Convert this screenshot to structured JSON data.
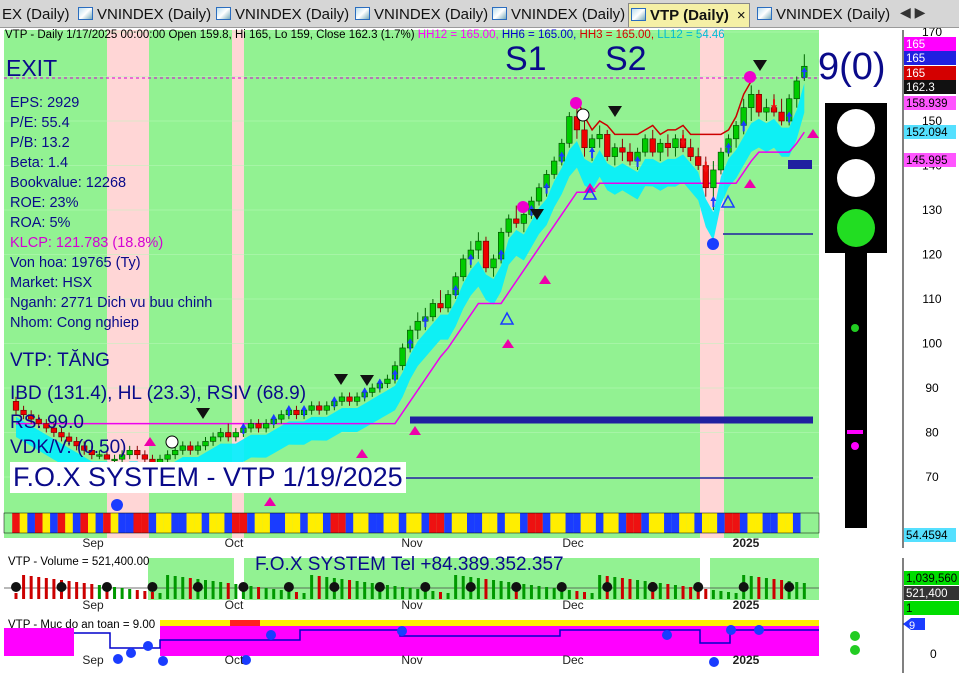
{
  "tabs": [
    {
      "label": "EX (Daily)",
      "active": false
    },
    {
      "label": "VNINDEX (Daily)",
      "active": false
    },
    {
      "label": "VNINDEX (Daily)",
      "active": false
    },
    {
      "label": "VNINDEX (Daily)",
      "active": false
    },
    {
      "label": "VNINDEX (Daily)",
      "active": false
    },
    {
      "label": "VTP (Daily)",
      "active": true
    },
    {
      "label": "VNINDEX (Daily)",
      "active": false
    }
  ],
  "tab_close": "×",
  "tab_nav": "◀ ▶",
  "header_parts": [
    {
      "text": "VTP - Daily 1/17/2025 00:00:00 Open 159.8, Hi 165, Lo 159, Close 162.3 (1.7%) ",
      "color": "#000000"
    },
    {
      "text": "HH12 = 165.00, ",
      "color": "#ff00ff"
    },
    {
      "text": "HH6 = 165.00, ",
      "color": "#0000cc"
    },
    {
      "text": "HH3 = 165.00, ",
      "color": "#d40000"
    },
    {
      "text": "LL12 = 54.46",
      "color": "#00bcd4"
    }
  ],
  "exit_label": "EXIT",
  "s1_label": "S1",
  "s2_label": "S2",
  "signal_label": "9(0)",
  "fundamentals": [
    {
      "text": "EPS: 2929",
      "color": "#0a0a8a"
    },
    {
      "text": "P/E: 55.4",
      "color": "#0a0a8a"
    },
    {
      "text": "P/B: 13.2",
      "color": "#0a0a8a"
    },
    {
      "text": "Beta: 1.4",
      "color": "#0a0a8a"
    },
    {
      "text": "Bookvalue: 12268",
      "color": "#0a0a8a"
    },
    {
      "text": "ROE: 23%",
      "color": "#0a0a8a"
    },
    {
      "text": "ROA: 5%",
      "color": "#0a0a8a"
    },
    {
      "text": "KLCP: 121.783 (18.8%)",
      "color": "#d400d4"
    },
    {
      "text": "Von hoa: 19765 (Ty)",
      "color": "#0a0a8a"
    },
    {
      "text": "Market: HSX",
      "color": "#0a0a8a"
    },
    {
      "text": "Nganh: 2771 Dich vu buu chinh",
      "color": "#0a0a8a"
    },
    {
      "text": "Nhom: Cong nghiep",
      "color": "#0a0a8a"
    }
  ],
  "trend_label": "VTP: TĂNG",
  "ibd_label": "IBD (131.4), HL (23.3), RSIV (68.9)",
  "rs_label": "RS: 99.0",
  "vdk_label": "VDK/V:  (0.50)",
  "watermark": "F.O.X SYSTEM - VTP 1/19/2025",
  "phone_label": "F.O.X SYSTEM Tel +84.389.352.357",
  "volume_header": "VTP - Volume = 521,400.00",
  "safety_header": "VTP - Muc do an toan = 9.00",
  "price_axis": {
    "ticks": [
      "170",
      "160",
      "150",
      "140",
      "130",
      "120",
      "110",
      "100",
      "90",
      "80",
      "70"
    ]
  },
  "price_badges": [
    {
      "text": "165",
      "bg": "#ff00ff",
      "fg": "#ffffff"
    },
    {
      "text": "165",
      "bg": "#2020e0",
      "fg": "#ffffff"
    },
    {
      "text": "165",
      "bg": "#d40000",
      "fg": "#ffffff"
    },
    {
      "text": "162.3",
      "bg": "#111111",
      "fg": "#ffffff"
    },
    {
      "text": "158.939",
      "bg": "#ff55ff",
      "fg": "#000000"
    },
    {
      "text": "152.094",
      "bg": "#55e0ff",
      "fg": "#000000"
    },
    {
      "text": "145.995",
      "bg": "#ff55ff",
      "fg": "#000000"
    },
    {
      "text": "54.4594",
      "bg": "#55e0ff",
      "fg": "#000000"
    }
  ],
  "volume_badges": [
    {
      "text": "1,039,560",
      "bg": "#00dd00",
      "fg": "#000000"
    },
    {
      "text": "521,400",
      "bg": "#333333",
      "fg": "#ffffff"
    },
    {
      "text": "1",
      "bg": "#00dd00",
      "fg": "#000000"
    }
  ],
  "safety_axis": {
    "tick": "0",
    "badge": "9"
  },
  "month_labels": [
    "Sep",
    "Oct",
    "Nov",
    "Dec",
    "2025"
  ],
  "colors": {
    "bull": "#00cc00",
    "bear": "#ee0000",
    "cyan_band": "#00f0ff",
    "pink_line": "#ee00ee",
    "panel_green": "#92f292",
    "panel_pink": "#ffd6d6",
    "hline": "#2020a0"
  },
  "chart_data": {
    "type": "candlestick",
    "title": "VTP - Daily",
    "ylim": [
      65,
      175
    ],
    "candles": [
      [
        87,
        88,
        84,
        85
      ],
      [
        85,
        86,
        83,
        84
      ],
      [
        84,
        85,
        82,
        83
      ],
      [
        83,
        84,
        81,
        82
      ],
      [
        82,
        83,
        80,
        81
      ],
      [
        81,
        82,
        79,
        80
      ],
      [
        80,
        81,
        78,
        79
      ],
      [
        79,
        80,
        77,
        78
      ],
      [
        78,
        79,
        76,
        77
      ],
      [
        77,
        78,
        75,
        76
      ],
      [
        76,
        77,
        74,
        75
      ],
      [
        75,
        76,
        74,
        75
      ],
      [
        75,
        76,
        74,
        74
      ],
      [
        74,
        75,
        73,
        74
      ],
      [
        74,
        76,
        73,
        75
      ],
      [
        75,
        77,
        74,
        76
      ],
      [
        76,
        77,
        74,
        75
      ],
      [
        75,
        76,
        73,
        74
      ],
      [
        74,
        75,
        72,
        73
      ],
      [
        73,
        75,
        72,
        74
      ],
      [
        74,
        76,
        73,
        75
      ],
      [
        75,
        77,
        74,
        76
      ],
      [
        76,
        78,
        75,
        77
      ],
      [
        77,
        78,
        75,
        76
      ],
      [
        76,
        78,
        75,
        77
      ],
      [
        77,
        79,
        76,
        78
      ],
      [
        78,
        80,
        77,
        79
      ],
      [
        79,
        81,
        78,
        80
      ],
      [
        80,
        82,
        78,
        79
      ],
      [
        79,
        81,
        78,
        80
      ],
      [
        80,
        82,
        79,
        81
      ],
      [
        81,
        83,
        80,
        82
      ],
      [
        82,
        83,
        80,
        81
      ],
      [
        81,
        83,
        80,
        82
      ],
      [
        82,
        84,
        81,
        83
      ],
      [
        83,
        85,
        82,
        84
      ],
      [
        84,
        86,
        83,
        85
      ],
      [
        85,
        86,
        83,
        84
      ],
      [
        84,
        86,
        83,
        85
      ],
      [
        85,
        87,
        84,
        86
      ],
      [
        86,
        87,
        84,
        85
      ],
      [
        85,
        87,
        84,
        86
      ],
      [
        86,
        88,
        85,
        87
      ],
      [
        87,
        89,
        86,
        88
      ],
      [
        88,
        89,
        86,
        87
      ],
      [
        87,
        89,
        86,
        88
      ],
      [
        88,
        90,
        87,
        89
      ],
      [
        89,
        91,
        88,
        90
      ],
      [
        90,
        92,
        89,
        91
      ],
      [
        91,
        93,
        90,
        92
      ],
      [
        92,
        96,
        91,
        95
      ],
      [
        95,
        100,
        94,
        99
      ],
      [
        99,
        104,
        98,
        103
      ],
      [
        103,
        107,
        101,
        105
      ],
      [
        105,
        108,
        103,
        106
      ],
      [
        106,
        110,
        105,
        109
      ],
      [
        109,
        112,
        107,
        108
      ],
      [
        108,
        112,
        107,
        111
      ],
      [
        111,
        116,
        110,
        115
      ],
      [
        115,
        120,
        114,
        119
      ],
      [
        119,
        123,
        117,
        121
      ],
      [
        121,
        125,
        119,
        123
      ],
      [
        123,
        124,
        116,
        117
      ],
      [
        117,
        120,
        115,
        119
      ],
      [
        119,
        126,
        118,
        125
      ],
      [
        125,
        129,
        124,
        128
      ],
      [
        128,
        131,
        126,
        127
      ],
      [
        127,
        130,
        125,
        129
      ],
      [
        129,
        133,
        128,
        132
      ],
      [
        132,
        136,
        131,
        135
      ],
      [
        135,
        139,
        133,
        138
      ],
      [
        138,
        142,
        137,
        141
      ],
      [
        141,
        146,
        140,
        145
      ],
      [
        145,
        152,
        144,
        151
      ],
      [
        151,
        154,
        146,
        148
      ],
      [
        148,
        150,
        142,
        144
      ],
      [
        144,
        147,
        141,
        146
      ],
      [
        146,
        149,
        144,
        147
      ],
      [
        147,
        148,
        141,
        142
      ],
      [
        142,
        145,
        140,
        144
      ],
      [
        144,
        146,
        141,
        143
      ],
      [
        143,
        145,
        140,
        141
      ],
      [
        141,
        144,
        139,
        143
      ],
      [
        143,
        147,
        142,
        146
      ],
      [
        146,
        148,
        142,
        143
      ],
      [
        143,
        146,
        141,
        145
      ],
      [
        145,
        147,
        142,
        144
      ],
      [
        144,
        147,
        142,
        146
      ],
      [
        146,
        148,
        143,
        144
      ],
      [
        144,
        146,
        141,
        142
      ],
      [
        142,
        144,
        139,
        140
      ],
      [
        140,
        142,
        133,
        135
      ],
      [
        135,
        141,
        130,
        139
      ],
      [
        139,
        144,
        138,
        143
      ],
      [
        143,
        147,
        142,
        146
      ],
      [
        146,
        150,
        144,
        149
      ],
      [
        149,
        155,
        147,
        153
      ],
      [
        153,
        158,
        150,
        156
      ],
      [
        156,
        157,
        151,
        152
      ],
      [
        152,
        155,
        150,
        153
      ],
      [
        153,
        156,
        151,
        152
      ],
      [
        152,
        155,
        149,
        150
      ],
      [
        150,
        156,
        149,
        155
      ],
      [
        155,
        160,
        153,
        159
      ],
      [
        159.8,
        165,
        159,
        162.3
      ]
    ],
    "volume_avg": 1039560,
    "volume_last": 521400,
    "safety_last": 9
  }
}
